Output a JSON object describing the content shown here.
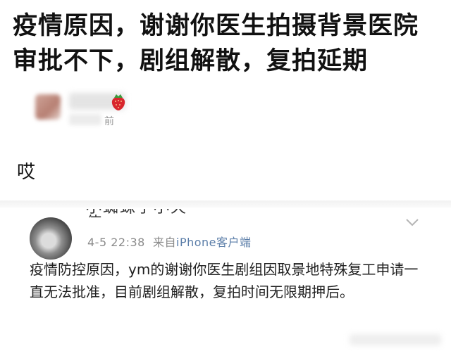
{
  "post": {
    "title": "疫情原因，谢谢你医生拍摄背景医院审批不下，剧组解散，复拍延期"
  },
  "author": {
    "time_suffix": "前",
    "emoji_icon": "strawberry-icon"
  },
  "reply": {
    "text": "哎"
  },
  "card": {
    "author_partial": "小蜘蛛子小天使",
    "time": "4-5 22:38",
    "from_label": "来自",
    "source": "iPhone客户端",
    "body": "疫情防控原因，ym的谢谢你医生剧组因取景地特殊复工申请一直无法批准，目前剧组解散，复拍时间无限期押后。",
    "menu_icon": "chevron-down-icon"
  }
}
